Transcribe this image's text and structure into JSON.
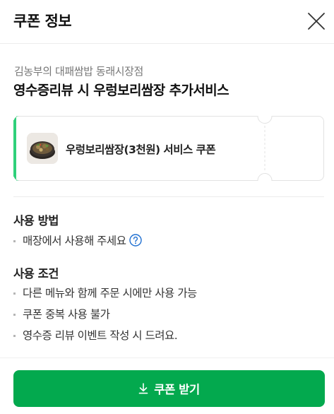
{
  "header": {
    "title": "쿠폰 정보",
    "close_icon": "close-icon"
  },
  "coupon": {
    "store_name": "김농부의 대패쌈밥 동래시장점",
    "title": "영수증리뷰 시 우렁보리쌈장 추가서비스",
    "ticket": {
      "label": "우렁보리쌈장(3천원) 서비스 쿠폰",
      "image": "food-thumbnail",
      "accent_color": "#2fd07a"
    }
  },
  "usage_method": {
    "heading": "사용 방법",
    "items": [
      "매장에서 사용해 주세요"
    ],
    "help_icon": "question-circle-icon"
  },
  "usage_conditions": {
    "heading": "사용 조건",
    "items": [
      "다른 메뉴와 함께 주문 시에만 사용 가능",
      "쿠폰 중복 사용 불가",
      "영수증 리뷰 이벤트 작성 시 드려요."
    ]
  },
  "action": {
    "receive_label": "쿠폰 받기",
    "icon": "download-icon",
    "color": "#03a94e"
  }
}
